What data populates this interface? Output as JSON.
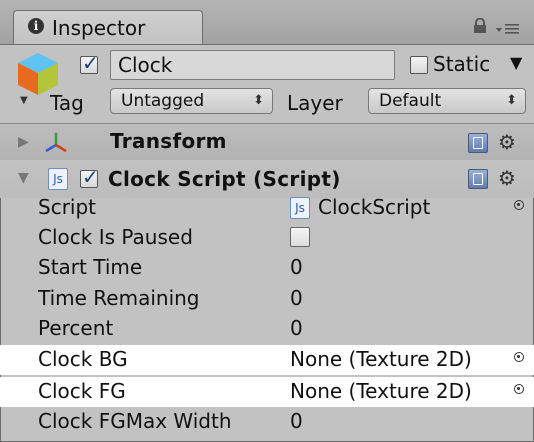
{
  "tab": {
    "label": "Inspector"
  },
  "gameobject": {
    "active": true,
    "name": "Clock",
    "static_label": "Static",
    "tag_label": "Tag",
    "tag_value": "Untagged",
    "layer_label": "Layer",
    "layer_value": "Default"
  },
  "components": {
    "transform": {
      "title": "Transform",
      "expanded": false
    },
    "clock_script": {
      "title": "Clock Script (Script)",
      "enabled": true,
      "expanded": true
    }
  },
  "properties": [
    {
      "label": "Script",
      "value": "ClockScript",
      "type": "object",
      "highlight": false
    },
    {
      "label": "Clock Is Paused",
      "value": "",
      "type": "checkbox",
      "checked": false,
      "highlight": false
    },
    {
      "label": "Start Time",
      "value": "0",
      "type": "number",
      "highlight": false
    },
    {
      "label": "Time Remaining",
      "value": "0",
      "type": "number",
      "highlight": false
    },
    {
      "label": "Percent",
      "value": "0",
      "type": "number",
      "highlight": false
    },
    {
      "label": "Clock BG",
      "value": "None (Texture 2D)",
      "type": "object",
      "highlight": true
    },
    {
      "label": "Clock FG",
      "value": "None (Texture 2D)",
      "type": "object",
      "highlight": true
    },
    {
      "label": "Clock FGMax Width",
      "value": "0",
      "type": "number",
      "highlight": false
    }
  ],
  "icons": {
    "tab": "info-icon",
    "lock": "lock-icon",
    "menu": "menu-icon",
    "cube": "gameobject-cube-icon",
    "transform": "transform-axes-icon",
    "script": "js-script-icon",
    "help": "help-book-icon",
    "settings": "gear-icon",
    "picker": "object-picker-icon"
  },
  "colors": {
    "panel": "#c2c2c2",
    "highlight": "#ffffff",
    "script_icon": "#2a5ea8"
  }
}
